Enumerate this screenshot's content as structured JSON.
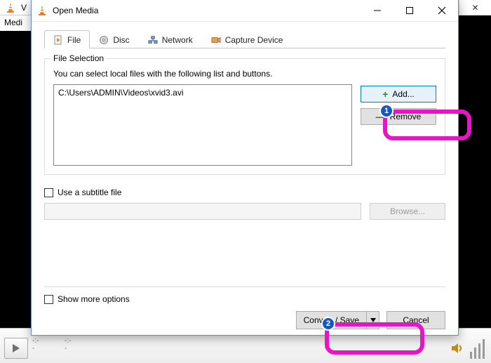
{
  "background": {
    "title_fragment": "V",
    "menu_fragment": "Medi",
    "seek_marks": "--:--"
  },
  "dialog": {
    "title": "Open Media",
    "tabs": {
      "file": "File",
      "disc": "Disc",
      "network": "Network",
      "capture": "Capture Device"
    },
    "file_selection": {
      "legend": "File Selection",
      "hint": "You can select local files with the following list and buttons.",
      "files": [
        "C:\\Users\\ADMIN\\Videos\\xvid3.avi"
      ],
      "add_label": "Add...",
      "remove_label": "Remove"
    },
    "subtitle": {
      "checkbox_label": "Use a subtitle file",
      "input_value": "",
      "browse_label": "Browse..."
    },
    "more_options_label": "Show more options",
    "convert_label": "Convert / Save",
    "cancel_label": "Cancel"
  },
  "annotations": {
    "badge1": "1",
    "badge2": "2"
  }
}
